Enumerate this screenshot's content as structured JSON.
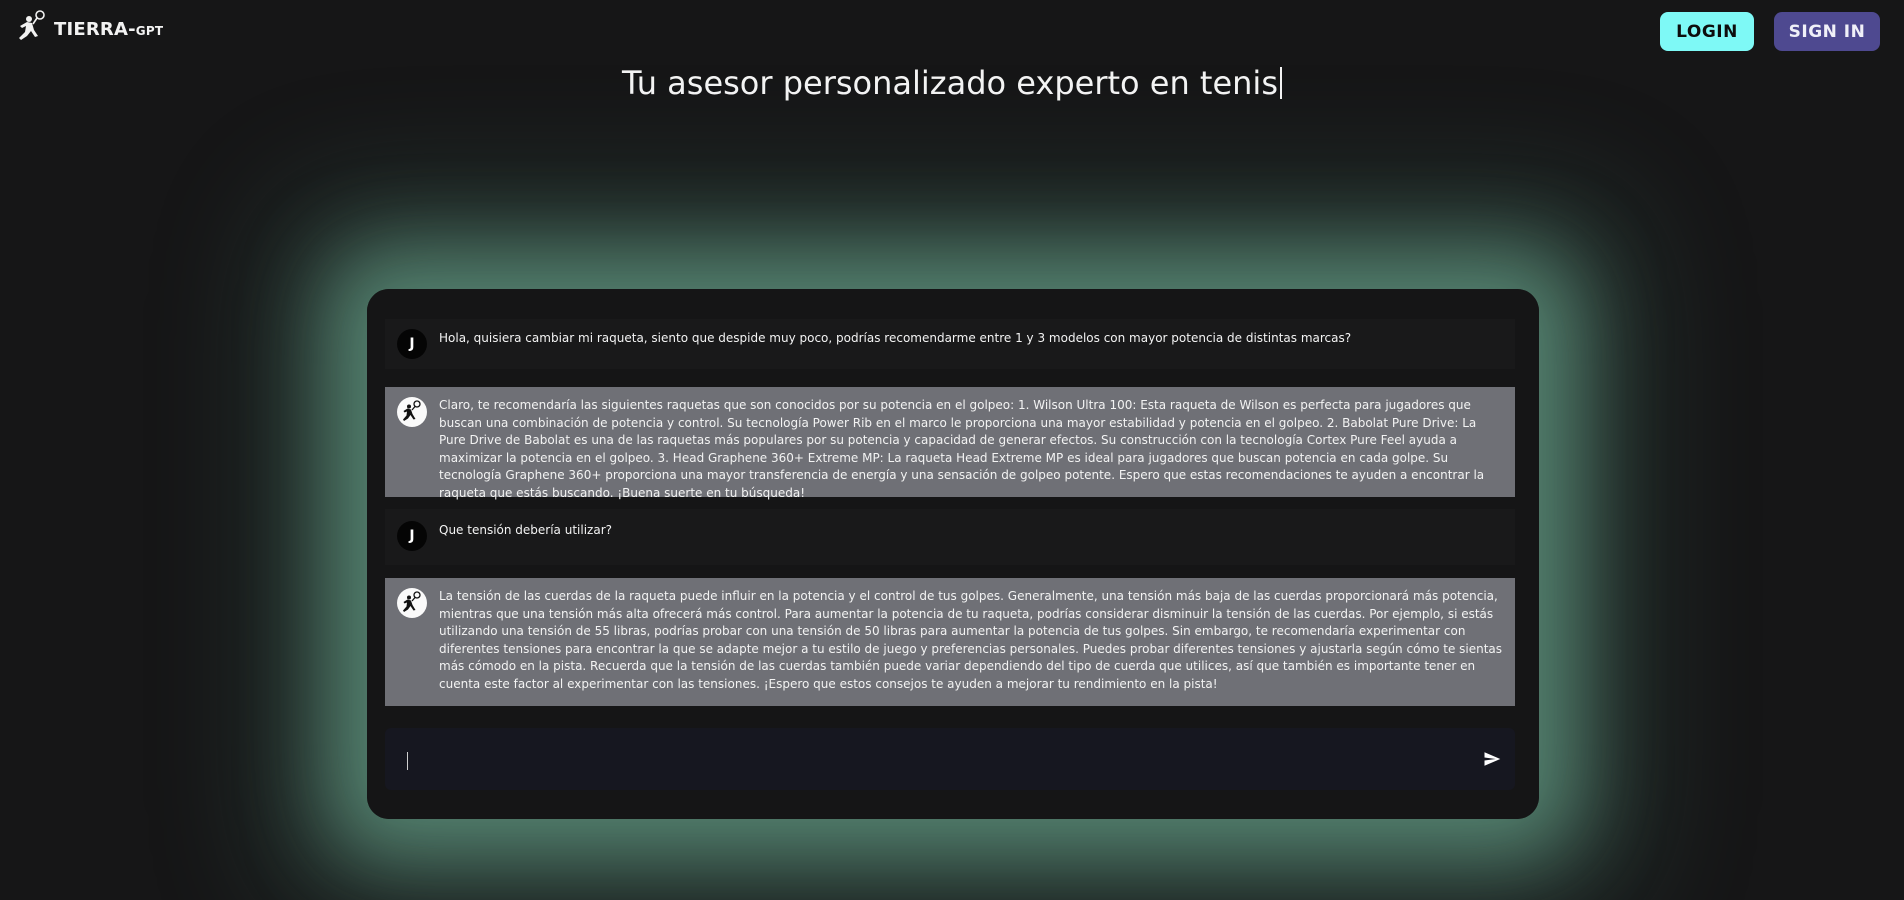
{
  "header": {
    "logo_main": "TIERRA-",
    "logo_sub": "GPT",
    "login_label": "LOGIN",
    "signin_label": "SIGN IN"
  },
  "hero": {
    "title": "Tu asesor personalizado experto en tenis"
  },
  "chat": {
    "messages": [
      {
        "role": "user",
        "avatar": "J",
        "text": "Hola, quisiera cambiar mi raqueta, siento que despide muy poco, podrías recomendarme entre 1 y 3 modelos con mayor potencia de distintas marcas?"
      },
      {
        "role": "bot",
        "avatar_icon": "tennis-player-icon",
        "text": "Claro, te recomendaría las siguientes raquetas que son conocidos por su potencia en el golpeo: 1. Wilson Ultra 100: Esta raqueta de Wilson es perfecta para jugadores que buscan una combinación de potencia y control. Su tecnología Power Rib en el marco le proporciona una mayor estabilidad y potencia en el golpeo. 2. Babolat Pure Drive: La Pure Drive de Babolat es una de las raquetas más populares por su potencia y capacidad de generar efectos. Su construcción con la tecnología Cortex Pure Feel ayuda a maximizar la potencia en el golpeo. 3. Head Graphene 360+ Extreme MP: La raqueta Head Extreme MP es ideal para jugadores que buscan potencia en cada golpe. Su tecnología Graphene 360+ proporciona una mayor transferencia de energía y una sensación de golpeo potente. Espero que estas recomendaciones te ayuden a encontrar la raqueta que estás buscando. ¡Buena suerte en tu búsqueda!"
      },
      {
        "role": "user",
        "avatar": "J",
        "text": "Que tensión debería utilizar?"
      },
      {
        "role": "bot",
        "avatar_icon": "tennis-player-icon",
        "text": "La tensión de las cuerdas de la raqueta puede influir en la potencia y el control de tus golpes. Generalmente, una tensión más baja de las cuerdas proporcionará más potencia, mientras que una tensión más alta ofrecerá más control. Para aumentar la potencia de tu raqueta, podrías considerar disminuir la tensión de las cuerdas. Por ejemplo, si estás utilizando una tensión de 55 libras, podrías probar con una tensión de 50 libras para aumentar la potencia de tus golpes. Sin embargo, te recomendaría experimentar con diferentes tensiones para encontrar la que se adapte mejor a tu estilo de juego y preferencias personales. Puedes probar diferentes tensiones y ajustarla según cómo te sientas más cómodo en la pista. Recuerda que la tensión de las cuerdas también puede variar dependiendo del tipo de cuerda que utilices, así que también es importante tener en cuenta este factor al experimentar con las tensiones. ¡Espero que estos consejos te ayuden a mejorar tu rendimiento en la pista!"
      }
    ],
    "input": {
      "value": "",
      "send_icon": "send-icon"
    }
  },
  "colors": {
    "background": "#161617",
    "login_button": "#7ef9f6",
    "signin_button": "#4e4990",
    "bot_message_bg": "#6f7076",
    "glow": "#78bea0"
  }
}
